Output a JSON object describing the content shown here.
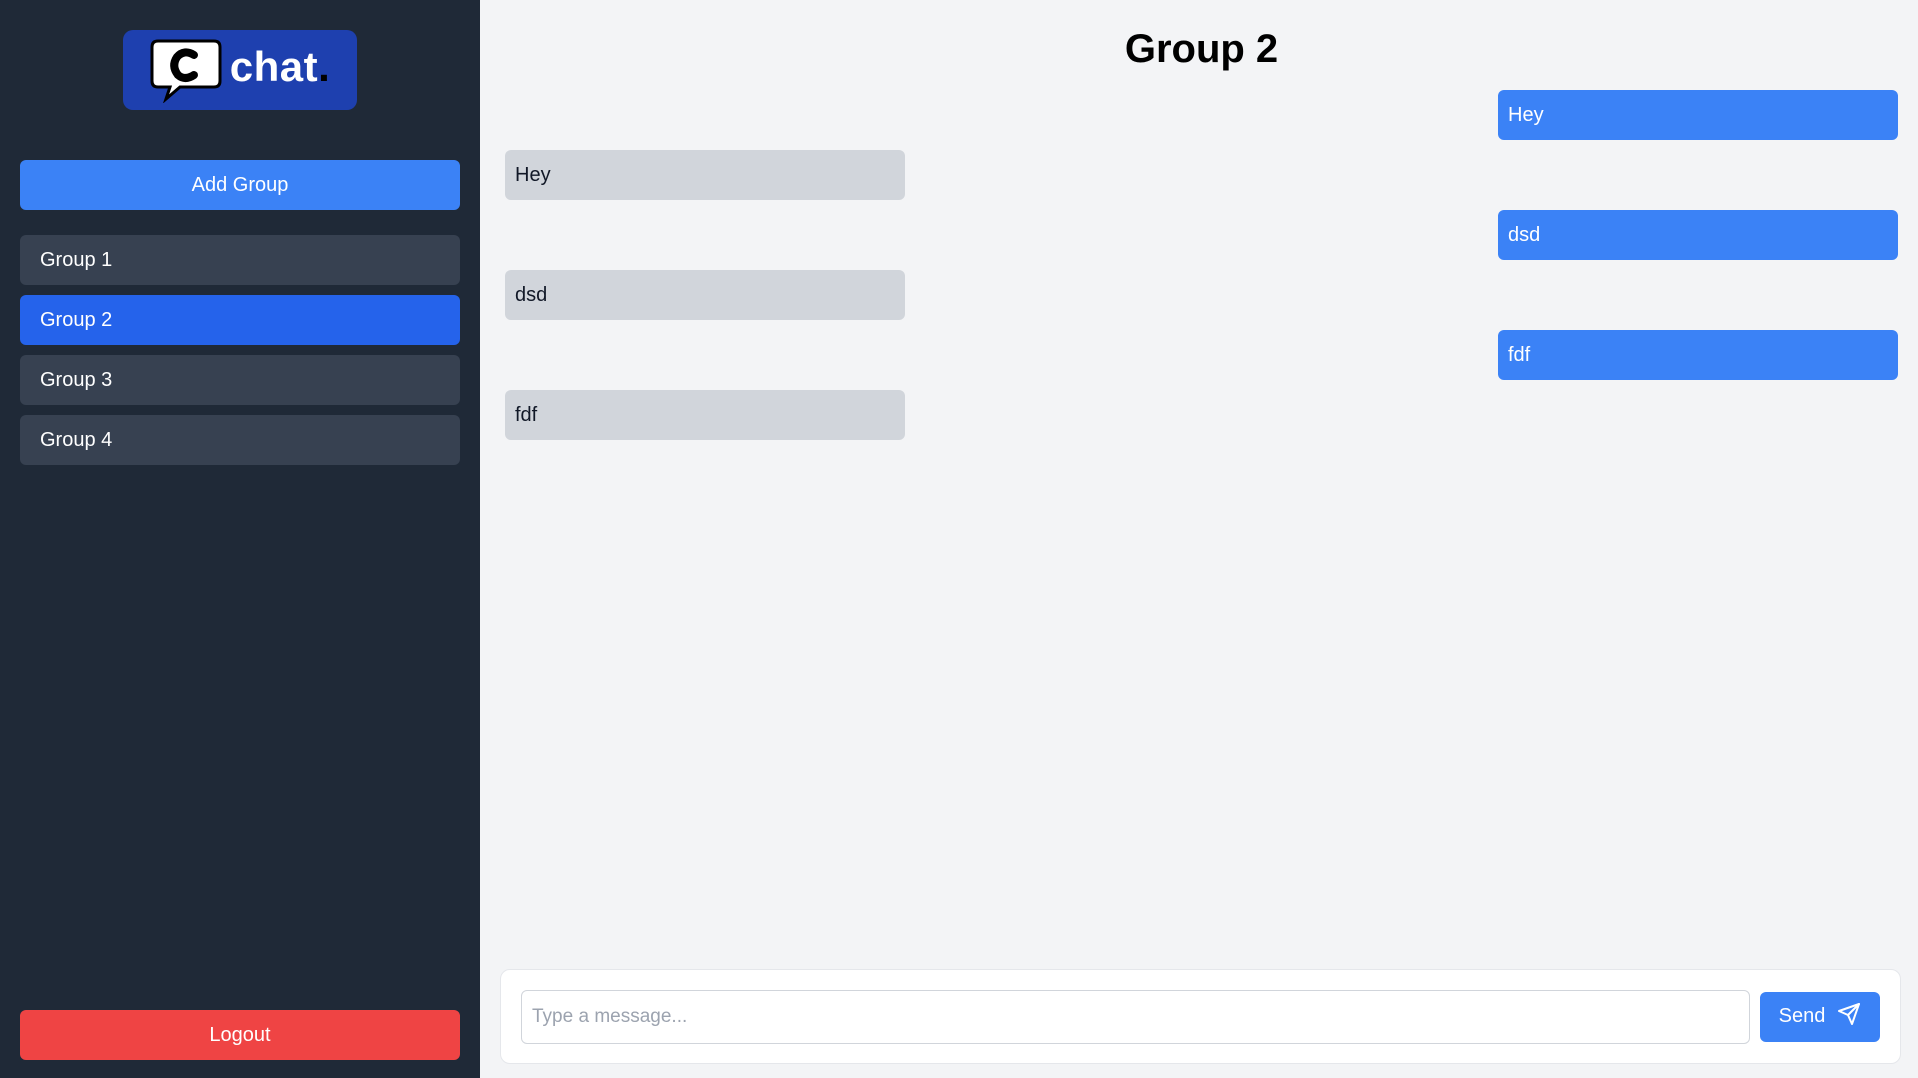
{
  "sidebar": {
    "logo_text": "chat",
    "logo_dot": ".",
    "add_group_label": "Add Group",
    "groups": [
      {
        "label": "Group 1"
      },
      {
        "label": "Group 2"
      },
      {
        "label": "Group 3"
      },
      {
        "label": "Group 4"
      }
    ],
    "active_group": "Group 2",
    "logout_label": "Logout"
  },
  "chat": {
    "title": "Group 2",
    "messages": [
      {
        "text": "Hey",
        "direction": "sent"
      },
      {
        "text": "Hey",
        "direction": "received"
      },
      {
        "text": "dsd",
        "direction": "sent"
      },
      {
        "text": "dsd",
        "direction": "received"
      },
      {
        "text": "fdf",
        "direction": "sent"
      },
      {
        "text": "fdf",
        "direction": "received"
      }
    ]
  },
  "composer": {
    "placeholder": "Type a message...",
    "value": "",
    "send_label": "Send",
    "send_icon": "send-icon"
  },
  "colors": {
    "sidebar_bg": "#1f2937",
    "accent": "#3b82f6",
    "active_group": "#2563eb",
    "logout": "#ef4444",
    "received_bubble": "#d1d5db",
    "logo_bg": "#1e40af"
  }
}
